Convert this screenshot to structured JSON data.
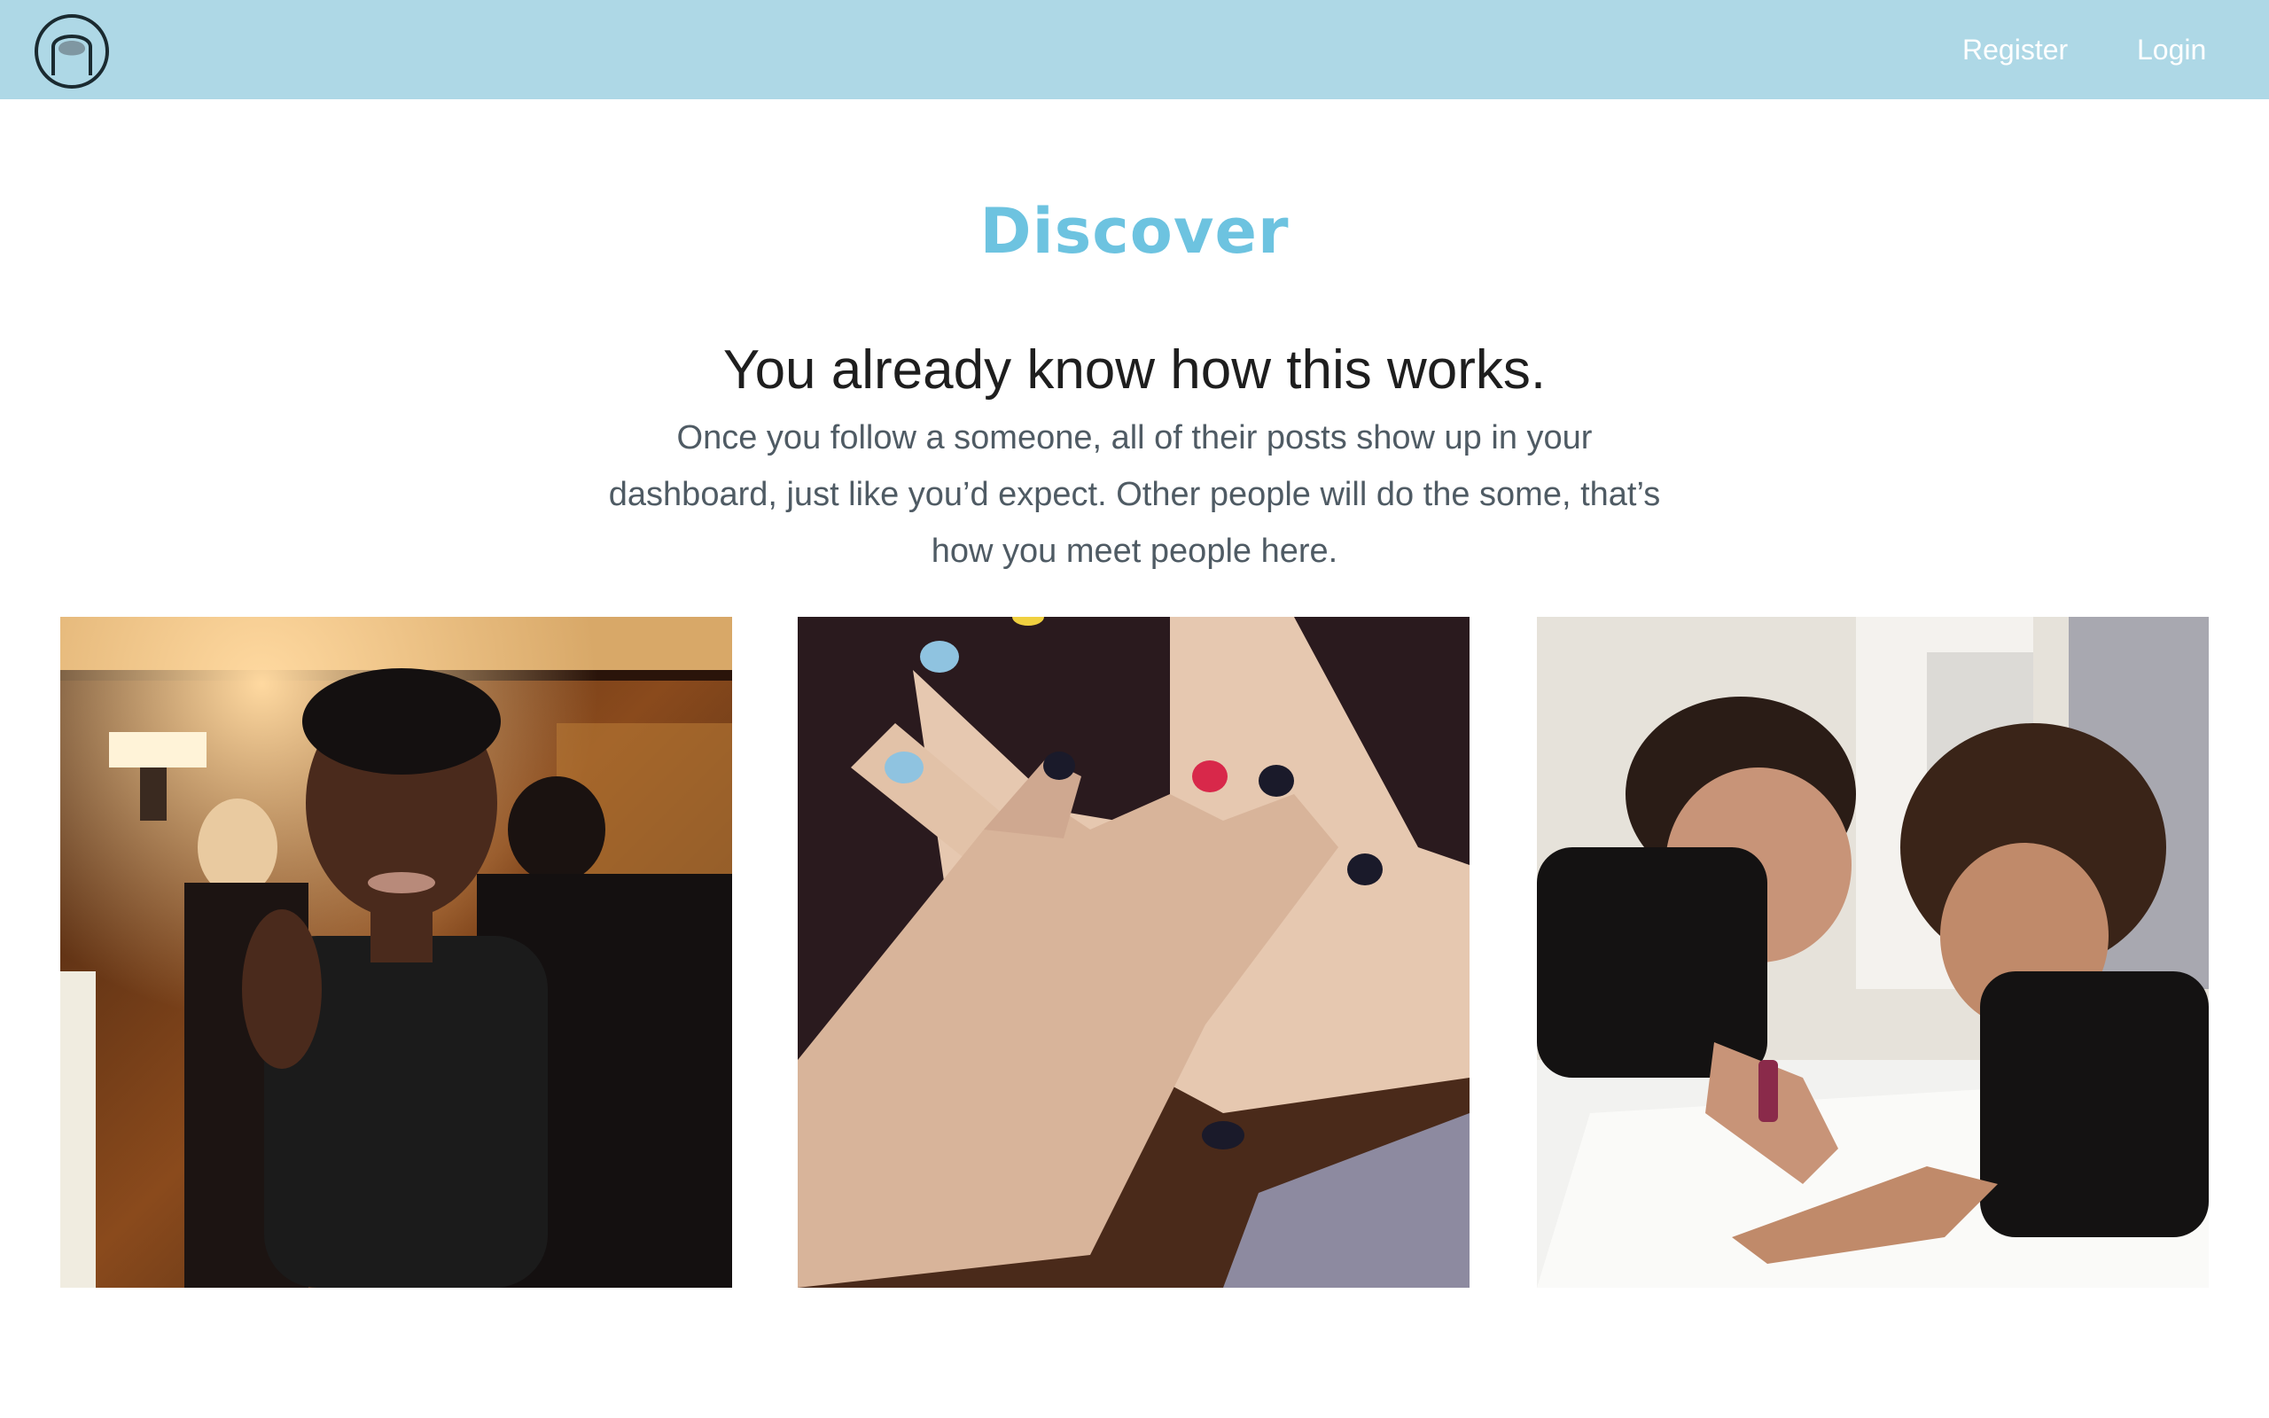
{
  "header": {
    "logo_icon": "fingernail-logo-icon",
    "nav": {
      "register_label": "Register",
      "login_label": "Login"
    }
  },
  "main": {
    "title": "Discover",
    "headline": "You already know how this works.",
    "description": "Once you follow a someone, all of their posts show up in your dashboard, just like you’d expect. Other people will do the some, that’s how you meet people here."
  },
  "colors": {
    "header_bg": "#aed8e6",
    "title": "#6dc3e0",
    "headline": "#1e1e1e",
    "description": "#4f5b64"
  }
}
